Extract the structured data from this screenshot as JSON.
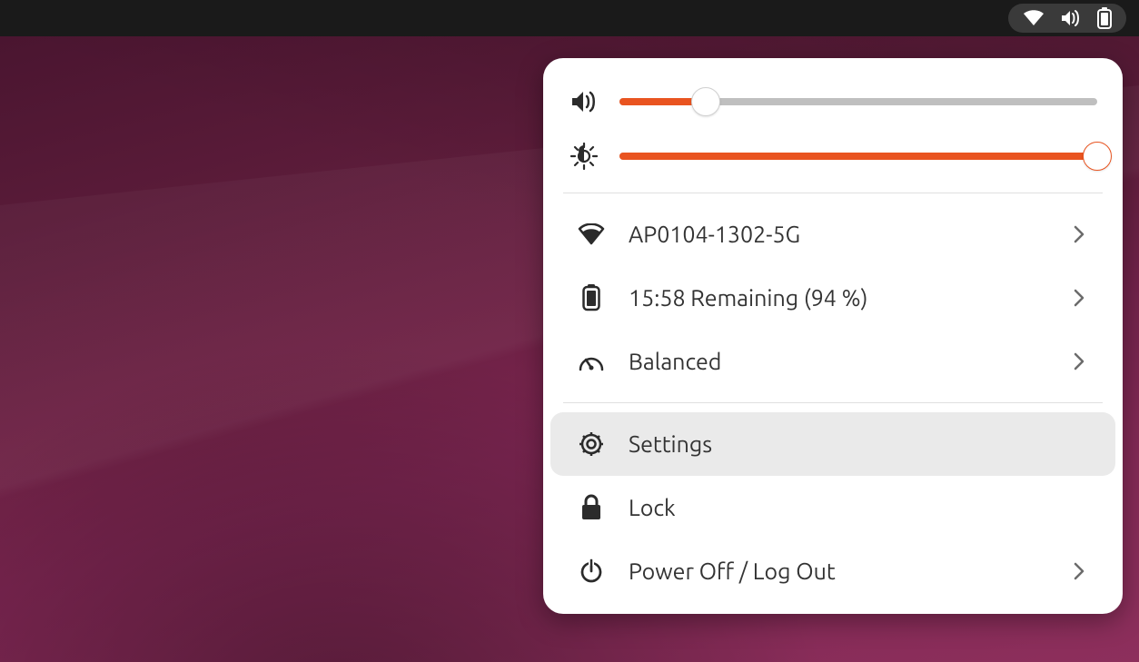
{
  "topbar": {
    "icons": [
      "wifi-icon",
      "volume-icon",
      "battery-icon"
    ]
  },
  "panel": {
    "volume_percent": 18,
    "brightness_percent": 100,
    "wifi_label": "AP0104-1302-5G",
    "battery_label": "15:58 Remaining (94 %)",
    "power_mode_label": "Balanced",
    "settings_label": "Settings",
    "lock_label": "Lock",
    "power_off_label": "Power Off / Log Out"
  },
  "colors": {
    "accent": "#e95420"
  }
}
